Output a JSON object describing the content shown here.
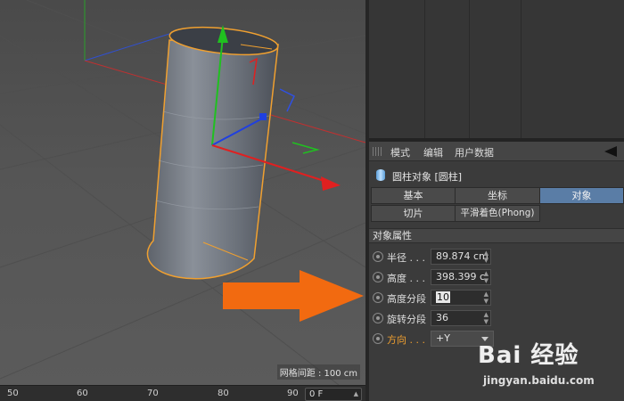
{
  "viewport": {
    "grid_spacing_label": "网格间距 : 100 cm"
  },
  "timeline": {
    "ticks": [
      "50",
      "60",
      "70",
      "80",
      "90"
    ],
    "frame_field": "0 F"
  },
  "attribute_manager": {
    "menu": [
      "模式",
      "编辑",
      "用户数据"
    ],
    "object_title": "圆柱对象 [圆柱]",
    "tabs_row1": [
      {
        "label": "基本",
        "active": false
      },
      {
        "label": "坐标",
        "active": false
      },
      {
        "label": "对象",
        "active": true
      }
    ],
    "tabs_row2": [
      {
        "label": "切片",
        "active": false
      },
      {
        "label": "平滑着色(Phong)",
        "active": false
      }
    ],
    "section_title": "对象属性",
    "properties": [
      {
        "label": "半径 . . .",
        "value": "89.874 cm",
        "kind": "number"
      },
      {
        "label": "高度 . . .",
        "value": "398.399 c",
        "kind": "number"
      },
      {
        "label": "高度分段",
        "value": "10",
        "kind": "number-editing"
      },
      {
        "label": "旋转分段",
        "value": "36",
        "kind": "number"
      },
      {
        "label": "方向 . . .",
        "value": "+Y",
        "kind": "select"
      }
    ]
  },
  "watermark": {
    "brand": "Bai 经验",
    "url": "jingyan.baidu.com"
  },
  "colors": {
    "selection_outline": "#f0a030",
    "active_tab": "#5a7da6",
    "pointer_arrow": "#f26a10",
    "axis_x": "#e02020",
    "axis_y": "#20c020",
    "axis_z": "#2040e0"
  }
}
